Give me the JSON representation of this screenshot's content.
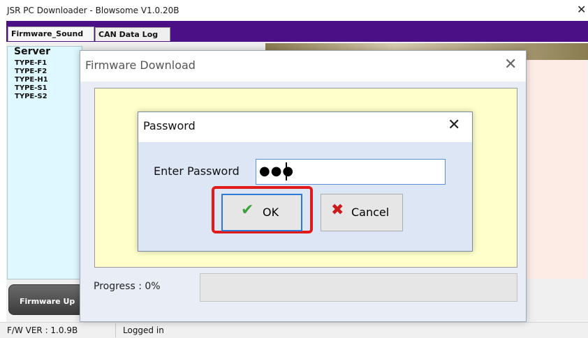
{
  "app": {
    "title": "JSR PC Downloader - Blowsome V1.0.20B",
    "close_glyph": "✕"
  },
  "tabs": [
    {
      "label": "Firmware_Sound",
      "selected": true
    },
    {
      "label": "CAN Data Log",
      "selected": false
    }
  ],
  "server_panel": {
    "header": "Server",
    "items": [
      "TYPE-F1",
      "TYPE-F2",
      "TYPE-H1",
      "TYPE-S1",
      "TYPE-S2"
    ]
  },
  "buttons": {
    "firmware_update": "Firmware Up"
  },
  "status_bar": {
    "fw_version": "F/W VER : 1.0.9B",
    "login_status": "Logged in"
  },
  "firmware_dialog": {
    "title": "Firmware Download",
    "close_glyph": "✕",
    "progress_label": "Progress : 0%",
    "progress": 0
  },
  "password_dialog": {
    "title": "Password",
    "close_glyph": "✕",
    "label": "Enter Password",
    "masked_value": "●●●",
    "ok_label": "OK",
    "cancel_label": "Cancel",
    "ok_icon": "check-icon",
    "cancel_icon": "x-icon"
  },
  "colors": {
    "tab_strip": "#4b0f86",
    "server_panel": "#dff8ff",
    "yellow_panel": "#ffffcc",
    "highlight": "#e11a1a",
    "ok_check": "#3fa13a",
    "cancel_x": "#cc1b1b"
  }
}
